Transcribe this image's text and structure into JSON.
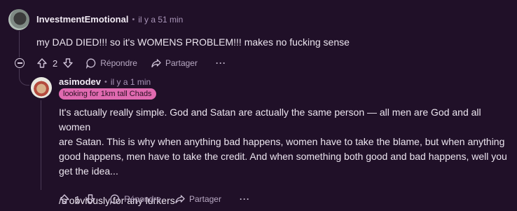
{
  "comment1": {
    "username": "InvestmentEmotional",
    "separator": "•",
    "time": "il y a 51 min",
    "body": "my DAD DIED!!! so it's WOMENS PROBLEM!!! makes no fucking sense",
    "votes": "2",
    "reply_label": "Répondre",
    "share_label": "Partager",
    "more_label": "···"
  },
  "comment2": {
    "username": "asimodev",
    "separator": "•",
    "time": "il y a 1 min",
    "flair": "looking for 1km tall Chads",
    "para1_lines": [
      "It's actually really simple. God and Satan are actually the same person — all men are God and all women",
      "are Satan. This is why when anything bad happens, women have to take the blame, but when anything",
      "good happens, men have to take the credit. And when something both good and bad happens, well you",
      "get the idea..."
    ],
    "para2": "/s obviously for any lurkers",
    "votes": "1",
    "reply_label": "Répondre",
    "share_label": "Partager",
    "more_label": "···"
  },
  "colors": {
    "background": "#201028",
    "flair_bg": "#e06ab0",
    "meta": "#a995b8"
  },
  "icons": [
    "upvote-icon",
    "downvote-icon",
    "reply-icon",
    "share-icon",
    "collapse-icon"
  ]
}
